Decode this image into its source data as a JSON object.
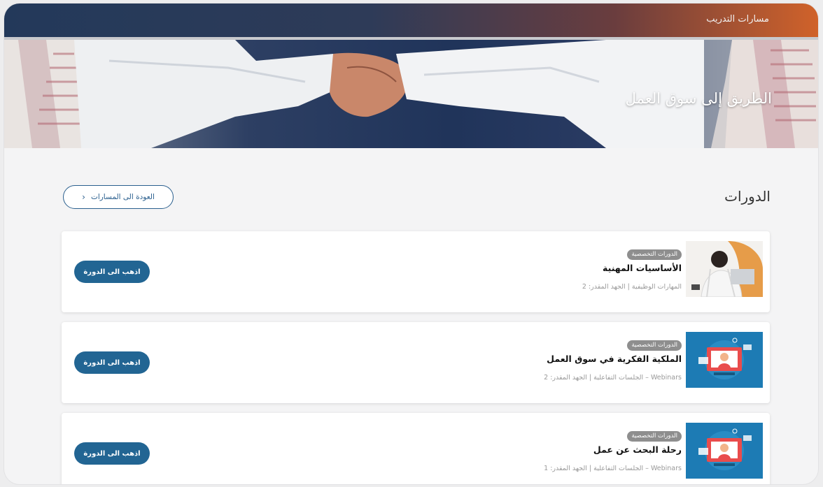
{
  "topbar": {
    "title": "مسارات التدريب"
  },
  "hero": {
    "title": "الطريق إلى سوق العمل"
  },
  "section": {
    "title": "الدورات",
    "back_label": "العودة الى المسارات"
  },
  "courses": [
    {
      "badge": "الدورات التخصصية",
      "title": "الأساسيات المهنية",
      "meta": "المهارات الوظيفية | الجهد المقدر: 2",
      "button": "اذهب الى الدورة",
      "thumb": "man-laptop-photo"
    },
    {
      "badge": "الدورات التخصصية",
      "title": "الملكية الفكرية في سوق العمل",
      "meta": "Webinars – الجلسات التفاعلية | الجهد المقدر: 2",
      "button": "اذهب الى الدورة",
      "thumb": "webinar-illustration"
    },
    {
      "badge": "الدورات التخصصية",
      "title": "رحلة البحث عن عمل",
      "meta": "Webinars – الجلسات التفاعلية | الجهد المقدر: 1",
      "button": "اذهب الى الدورة",
      "thumb": "webinar-illustration"
    }
  ],
  "colors": {
    "primary": "#226593",
    "badge": "#8e8e8e"
  }
}
